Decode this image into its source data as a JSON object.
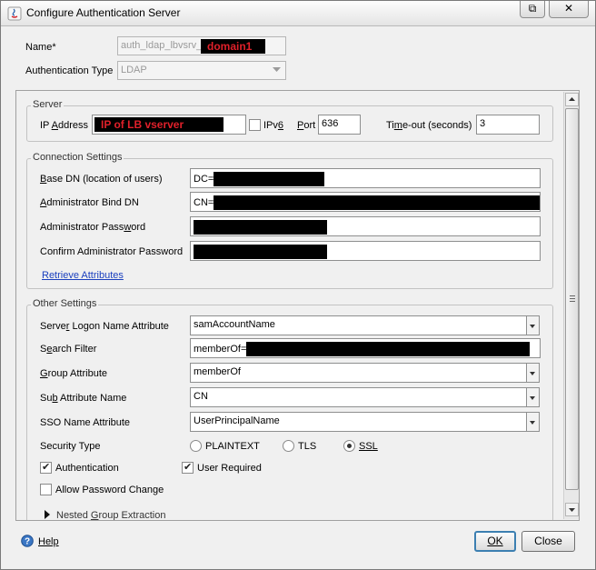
{
  "window": {
    "title": "Configure Authentication Server",
    "restore_glyph": "⧉",
    "close_glyph": "✕"
  },
  "top": {
    "name_label": "Name*",
    "name_prefix": "auth_ldap_lbvsrv_",
    "name_redacted_text": "domain1",
    "auth_type_label": "Authentication Type",
    "auth_type_value": "LDAP"
  },
  "server": {
    "group_title": "Server",
    "ip_label_pre": "IP ",
    "ip_label_ul": "A",
    "ip_label_post": "ddress",
    "ip_redacted_text": "IP of LB vserver",
    "ipv6_label_pre": "IPv",
    "ipv6_label_ul": "6",
    "port_label_ul": "P",
    "port_label_post": "ort",
    "port_value": "636",
    "timeout_label_pre": "Ti",
    "timeout_label_ul": "m",
    "timeout_label_post": "e-out (seconds)",
    "timeout_value": "3"
  },
  "connection": {
    "group_title": "Connection Settings",
    "base_dn_label_ul": "B",
    "base_dn_label_post": "ase DN (location of users)",
    "base_dn_prefix": "DC=",
    "bind_dn_label_ul": "A",
    "bind_dn_label_post": "dministrator Bind DN",
    "bind_dn_prefix": "CN=",
    "password_label_pre": "Administrator Pass",
    "password_label_ul": "w",
    "password_label_post": "ord",
    "confirm_label_pre": "Confirm Administrator Password",
    "retrieve_link": "Retrieve Attributes"
  },
  "other": {
    "group_title": "Other Settings",
    "logon_attr_label_pre": "Serve",
    "logon_attr_label_ul": "r",
    "logon_attr_label_post": " Logon Name Attribute",
    "logon_attr_value": "samAccountName",
    "search_filter_label_pre": "S",
    "search_filter_label_ul": "e",
    "search_filter_label_post": "arch Filter",
    "search_filter_prefix": "memberOf=",
    "group_attr_label_ul": "G",
    "group_attr_label_post": "roup Attribute",
    "group_attr_value": "memberOf",
    "sub_attr_label_pre": "Su",
    "sub_attr_label_ul": "b",
    "sub_attr_label_post": " Attribute Name",
    "sub_attr_value": "CN",
    "sso_attr_label": "SSO Name Attribute",
    "sso_attr_value": "UserPrincipalName",
    "security_type_label": "Security Type",
    "security_options": [
      "PLAINTEXT",
      "TLS",
      "SSL"
    ],
    "security_selected": "SSL",
    "authentication_label": "Authentication",
    "user_required_label": "User Required",
    "allow_password_change_label": "Allow Password Change",
    "nested_group_label_pre": "Nested ",
    "nested_group_label_ul": "G",
    "nested_group_label_post": "roup Extraction"
  },
  "footer": {
    "help_label": "Help",
    "ok_label": "OK",
    "close_label": "Close"
  },
  "colors": {
    "link": "#1a3fbe",
    "redacted_text": "#e0202a",
    "default_button_border": "#3c7fb1"
  }
}
